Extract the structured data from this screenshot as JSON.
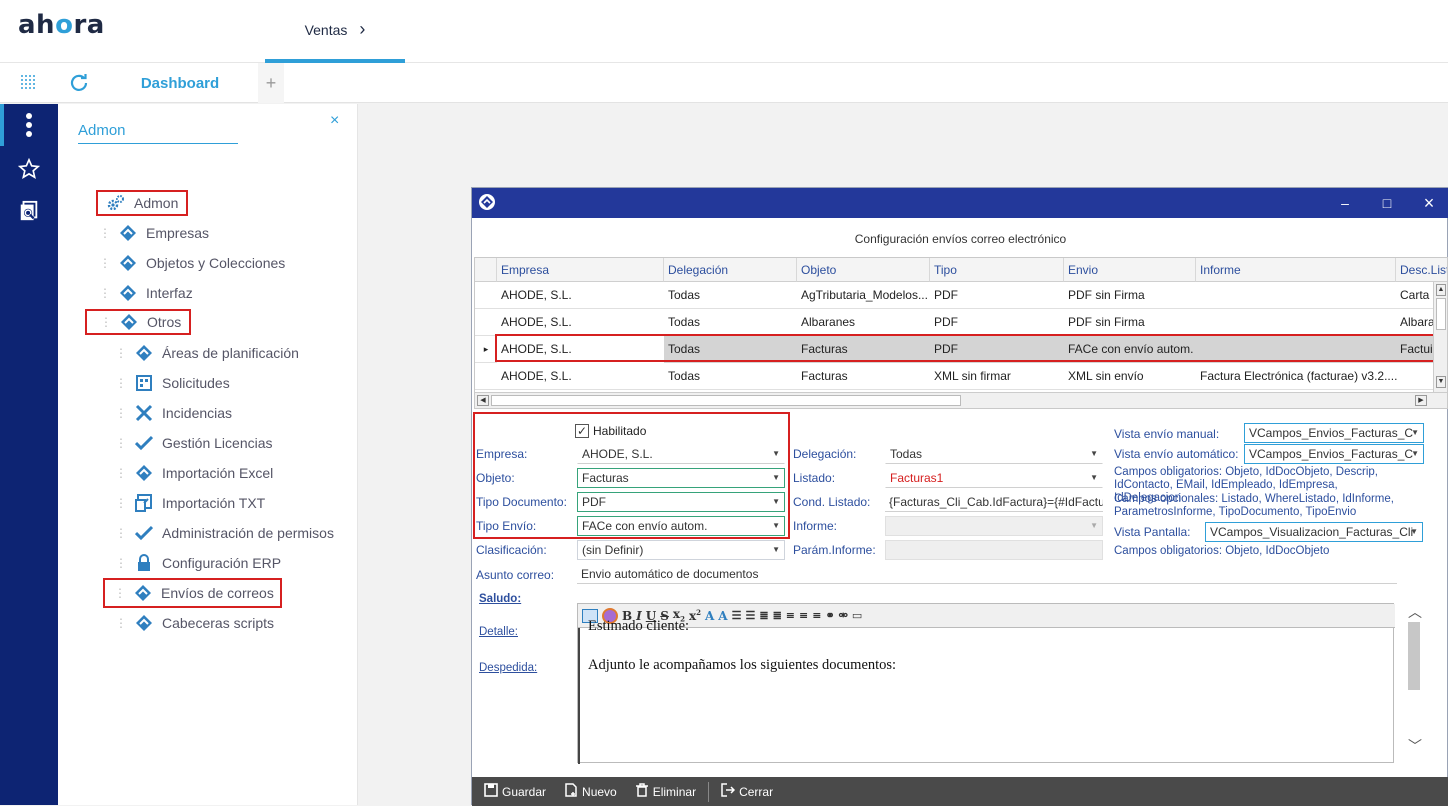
{
  "app": {
    "logo": "ahora"
  },
  "topnav": {
    "tab_label": "Ventas",
    "tab_chevron": "›"
  },
  "secbar": {
    "dashboard_label": "Dashboard",
    "plus": "+"
  },
  "sidebar": {
    "search_value": "Admon",
    "close": "×",
    "items": [
      {
        "label": "Admon",
        "icon": "gears-icon"
      },
      {
        "label": "Empresas",
        "icon": "ahora-icon"
      },
      {
        "label": "Objetos y Colecciones",
        "icon": "ahora-icon"
      },
      {
        "label": "Interfaz",
        "icon": "ahora-icon"
      },
      {
        "label": "Otros",
        "icon": "ahora-icon"
      },
      {
        "label": "Áreas de planificación",
        "icon": "ahora-icon"
      },
      {
        "label": "Solicitudes",
        "icon": "form-icon"
      },
      {
        "label": "Incidencias",
        "icon": "x-icon"
      },
      {
        "label": "Gestión Licencias",
        "icon": "check-icon"
      },
      {
        "label": "Importación Excel",
        "icon": "ahora-icon"
      },
      {
        "label": "Importación TXT",
        "icon": "import-icon"
      },
      {
        "label": "Administración de permisos",
        "icon": "check-icon"
      },
      {
        "label": "Configuración ERP",
        "icon": "lock-icon"
      },
      {
        "label": "Envíos de correos",
        "icon": "ahora-icon"
      },
      {
        "label": "Cabeceras scripts",
        "icon": "ahora-icon"
      }
    ]
  },
  "dialog": {
    "caption": "Configuración envíos correo electrónico",
    "controls": {
      "minimize": "–",
      "maximize": "□",
      "close": "×"
    },
    "grid": {
      "headers": [
        "Empresa",
        "Delegación",
        "Objeto",
        "Tipo",
        "Envio",
        "Informe",
        "Desc.List"
      ],
      "rows": [
        [
          "AHODE, S.L.",
          "Todas",
          "AgTributaria_Modelos...",
          "PDF",
          "PDF sin Firma",
          "",
          "Carta"
        ],
        [
          "AHODE, S.L.",
          "Todas",
          "Albaranes",
          "PDF",
          "PDF sin Firma",
          "",
          "Albara"
        ],
        [
          "AHODE, S.L.",
          "Todas",
          "Facturas",
          "PDF",
          "FACe con envío autom.",
          "",
          "Factui"
        ],
        [
          "AHODE, S.L.",
          "Todas",
          "Facturas",
          "XML sin firmar",
          "XML sin envío",
          "Factura Electrónica (facturae) v3.2....",
          ""
        ]
      ],
      "row_marker": "▸"
    },
    "form": {
      "habilitado_label": "Habilitado",
      "habilitado_check": "✓",
      "empresa_label": "Empresa:",
      "empresa_value": "AHODE, S.L.",
      "objeto_label": "Objeto:",
      "objeto_value": "Facturas",
      "tipo_doc_label": "Tipo Documento:",
      "tipo_doc_value": "PDF",
      "tipo_envio_label": "Tipo Envío:",
      "tipo_envio_value": "FACe con envío autom.",
      "clasificacion_label": "Clasificación:",
      "clasificacion_value": "(sin Definir)",
      "asunto_label": "Asunto correo:",
      "asunto_value": "Envio automático de documentos",
      "delegacion_label": "Delegación:",
      "delegacion_value": "Todas",
      "listado_label": "Listado:",
      "listado_value": "Facturas1",
      "cond_listado_label": "Cond. Listado:",
      "cond_listado_value": "{Facturas_Cli_Cab.IdFactura}={#IdFactur",
      "informe_label": "Informe:",
      "param_informe_label": "Parám.Informe:",
      "vista_manual_label": "Vista envío manual:",
      "vista_manual_value": "VCampos_Envios_Facturas_C",
      "vista_auto_label": "Vista envío automático:",
      "vista_auto_value": "VCampos_Envios_Facturas_C",
      "campos_obl": "Campos obligatorios: Objeto, IdDocObjeto, Descrip, IdContacto, EMail, IdEmpleado, IdEmpresa, IdDelegacion",
      "campos_opc": "Campos opcionales: Listado, WhereListado, IdInforme, ParametrosInforme, TipoDocumento, TipoEnvio",
      "vista_pantalla_label": "Vista Pantalla:",
      "vista_pantalla_value": "VCampos_Visualizacion_Facturas_Cli",
      "campos_obl2": "Campos obligatorios: Objeto, IdDocObjeto",
      "saludo_link": "Saludo:",
      "detalle_link": "Detalle:",
      "despedida_link": "Despedida:",
      "editor_line1": "Estimado cliente:",
      "editor_line2": "Adjunto le acompañamos los siguientes documentos:"
    },
    "bottom": {
      "guardar": "Guardar",
      "nuevo": "Nuevo",
      "eliminar": "Eliminar",
      "cerrar": "Cerrar"
    }
  },
  "colors": {
    "accent": "#2f9fd8",
    "rail": "#0d2473",
    "dialog_title": "#23389a",
    "highlight": "#d62020"
  }
}
